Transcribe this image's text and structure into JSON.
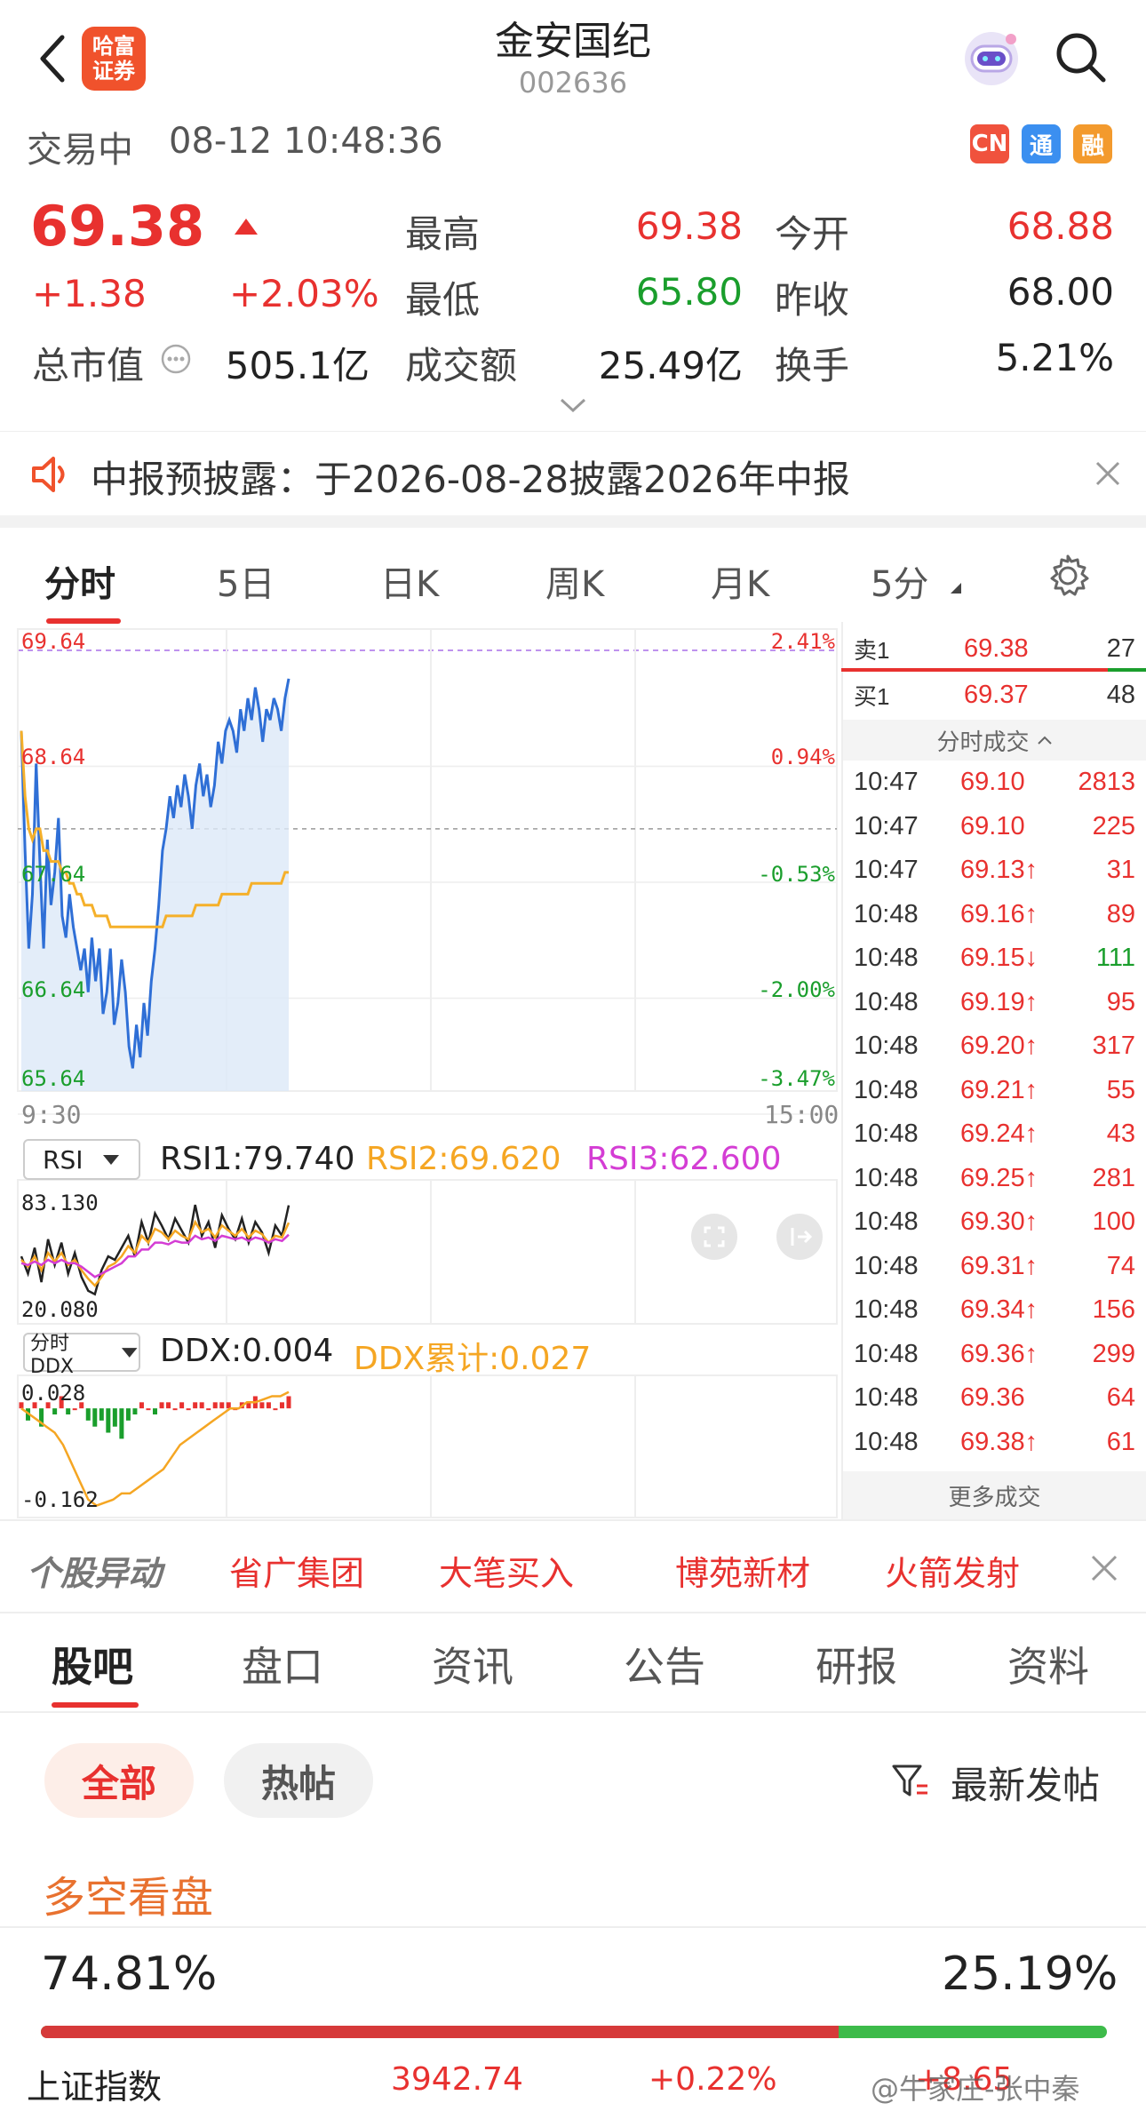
{
  "header": {
    "back_icon": "chevron-left-icon",
    "logo_line1": "哈富",
    "logo_line2": "证券",
    "stock_name": "金安国纪",
    "stock_code": "002636",
    "assistant_icon": "robot-avatar-icon",
    "search_icon": "search-icon"
  },
  "status": {
    "state": "交易中",
    "datetime": "08-12 10:48:36",
    "badges": [
      "CN",
      "通",
      "融"
    ],
    "badge_colors": [
      "#f0523d",
      "#3b8ff0",
      "#f39a2d"
    ]
  },
  "quote": {
    "price": "69.38",
    "change": "+1.38",
    "change_pct": "+2.03%",
    "mcap_label": "总市值",
    "mcap_value": "505.1亿",
    "high_label": "最高",
    "high_value": "69.38",
    "low_label": "最低",
    "low_value": "65.80",
    "amount_label": "成交额",
    "amount_value": "25.49亿",
    "open_label": "今开",
    "open_value": "68.88",
    "prev_label": "昨收",
    "prev_value": "68.00",
    "turnover_label": "换手",
    "turnover_value": "5.21%"
  },
  "notice": {
    "text": "中报预披露：于2026-08-28披露2026年中报"
  },
  "chart_tabs": [
    "分时",
    "5日",
    "日K",
    "周K",
    "月K",
    "5分"
  ],
  "chart_data": [
    {
      "type": "line",
      "title": "",
      "xlabel": "",
      "ylabel": "",
      "x_range": [
        "9:30",
        "15:00"
      ],
      "y_ticks_left": [
        "69.64",
        "68.64",
        "67.64",
        "66.64",
        "65.64"
      ],
      "y_ticks_right": [
        "2.41%",
        "0.94%",
        "-0.53%",
        "-2.00%",
        "-3.47%"
      ],
      "ylim": [
        65.64,
        69.64
      ],
      "prev_close": 68.0,
      "series": [
        {
          "values": [
            68.9,
            67.8,
            66.9,
            67.4,
            68.6,
            67.7,
            66.9,
            67.9,
            67.3,
            67.6,
            68.1,
            67.2,
            67.0,
            67.4,
            67.1,
            66.9,
            66.7,
            66.9,
            66.5,
            67.0,
            66.6,
            66.9,
            66.3,
            66.5,
            66.9,
            66.2,
            66.4,
            66.8,
            66.5,
            66.0,
            65.8,
            66.2,
            65.9,
            66.4,
            66.1,
            66.6,
            66.9,
            67.3,
            67.8,
            68.0,
            68.3,
            68.1,
            68.4,
            68.2,
            68.5,
            68.3,
            68.0,
            68.4,
            68.6,
            68.3,
            68.5,
            68.2,
            68.4,
            68.8,
            68.6,
            68.9,
            69.0,
            68.9,
            68.7,
            69.1,
            68.9,
            69.2,
            69.0,
            69.3,
            69.1,
            68.8,
            69.1,
            69.0,
            69.2,
            69.1,
            68.9,
            69.2,
            69.38
          ]
        },
        {
          "values": [
            68.9,
            68.3,
            68.0,
            67.9,
            68.0,
            68.0,
            67.8,
            67.8,
            67.7,
            67.7,
            67.7,
            67.6,
            67.6,
            67.5,
            67.5,
            67.4,
            67.4,
            67.3,
            67.3,
            67.3,
            67.2,
            67.2,
            67.2,
            67.2,
            67.1,
            67.1,
            67.1,
            67.1,
            67.1,
            67.1,
            67.1,
            67.1,
            67.1,
            67.1,
            67.1,
            67.1,
            67.1,
            67.1,
            67.1,
            67.2,
            67.2,
            67.2,
            67.2,
            67.2,
            67.2,
            67.2,
            67.2,
            67.3,
            67.3,
            67.3,
            67.3,
            67.3,
            67.3,
            67.3,
            67.4,
            67.4,
            67.4,
            67.4,
            67.4,
            67.4,
            67.4,
            67.4,
            67.5,
            67.5,
            67.5,
            67.5,
            67.5,
            67.5,
            67.5,
            67.5,
            67.5,
            67.6,
            67.6
          ]
        }
      ]
    },
    {
      "type": "line",
      "title": "RSI",
      "labels": [
        "RSI1:79.740",
        "RSI2:69.620",
        "RSI3:62.600"
      ],
      "ylim": [
        20.08,
        83.13
      ],
      "y_ticks": [
        "83.130",
        "20.080"
      ],
      "series": [
        {
          "values": [
            50,
            40,
            55,
            35,
            60,
            45,
            58,
            40,
            52,
            38,
            30,
            28,
            42,
            50,
            48,
            55,
            62,
            50,
            70,
            58,
            75,
            68,
            60,
            72,
            65,
            58,
            80,
            62,
            70,
            55,
            74,
            66,
            60,
            72,
            58,
            70,
            64,
            52,
            68,
            62,
            79.7
          ]
        },
        {
          "values": [
            48,
            44,
            50,
            42,
            52,
            47,
            52,
            45,
            48,
            42,
            37,
            33,
            38,
            44,
            46,
            50,
            56,
            52,
            62,
            58,
            66,
            64,
            60,
            65,
            62,
            60,
            70,
            64,
            66,
            61,
            68,
            65,
            62,
            66,
            61,
            65,
            63,
            58,
            62,
            61,
            69.6
          ]
        },
        {
          "values": [
            46,
            45,
            47,
            45,
            48,
            46,
            48,
            46,
            46,
            44,
            41,
            38,
            40,
            42,
            44,
            46,
            50,
            50,
            54,
            54,
            58,
            58,
            57,
            59,
            58,
            58,
            62,
            60,
            61,
            59,
            62,
            61,
            60,
            61,
            59,
            61,
            60,
            58,
            60,
            59,
            62.6
          ]
        }
      ]
    },
    {
      "type": "bar",
      "title": "分时DDX",
      "labels": [
        "DDX:0.004",
        "DDX累计:0.027"
      ],
      "ylim": [
        -0.162,
        0.028
      ],
      "y_ticks": [
        "0.028",
        "-0.162"
      ],
      "bars": [
        0.01,
        -0.02,
        0.01,
        -0.03,
        0.01,
        -0.01,
        0.02,
        -0.01,
        0.0,
        0.01,
        -0.02,
        -0.03,
        -0.02,
        -0.04,
        -0.03,
        -0.05,
        -0.02,
        -0.01,
        0.01,
        0.0,
        -0.01,
        0.01,
        0.01,
        0.0,
        0.01,
        0.0,
        0.01,
        0.01,
        0.0,
        0.01,
        0.01,
        0.01,
        0.0,
        0.01,
        0.01,
        0.02,
        0.01,
        0.01,
        0.0,
        0.01,
        0.02
      ],
      "cum": [
        0.0,
        -0.01,
        -0.02,
        -0.03,
        -0.04,
        -0.06,
        -0.09,
        -0.12,
        -0.15,
        -0.16,
        -0.155,
        -0.15,
        -0.14,
        -0.14,
        -0.13,
        -0.12,
        -0.11,
        -0.1,
        -0.08,
        -0.06,
        -0.05,
        -0.04,
        -0.03,
        -0.02,
        -0.01,
        0.0,
        0.0,
        0.01,
        0.01,
        0.015,
        0.02,
        0.02,
        0.027
      ]
    }
  ],
  "rsi_selector": "RSI",
  "ddx_selector": "分时DDX",
  "order_book": {
    "ask_label": "卖1",
    "ask_price": "69.38",
    "ask_vol": "27",
    "bid_label": "买1",
    "bid_price": "69.37",
    "bid_vol": "48",
    "ticks_header": "分时成交",
    "ticks": [
      {
        "t": "10:47",
        "p": "69.10",
        "v": "2813",
        "c": "#e8312f"
      },
      {
        "t": "10:47",
        "p": "69.10",
        "v": "225",
        "c": "#e8312f"
      },
      {
        "t": "10:47",
        "p": "69.13↑",
        "v": "31",
        "c": "#e8312f"
      },
      {
        "t": "10:48",
        "p": "69.16↑",
        "v": "89",
        "c": "#e8312f"
      },
      {
        "t": "10:48",
        "p": "69.15↓",
        "v": "111",
        "c": "#1a9e2c"
      },
      {
        "t": "10:48",
        "p": "69.19↑",
        "v": "95",
        "c": "#e8312f"
      },
      {
        "t": "10:48",
        "p": "69.20↑",
        "v": "317",
        "c": "#e8312f"
      },
      {
        "t": "10:48",
        "p": "69.21↑",
        "v": "55",
        "c": "#e8312f"
      },
      {
        "t": "10:48",
        "p": "69.24↑",
        "v": "43",
        "c": "#e8312f"
      },
      {
        "t": "10:48",
        "p": "69.25↑",
        "v": "281",
        "c": "#e8312f"
      },
      {
        "t": "10:48",
        "p": "69.30↑",
        "v": "100",
        "c": "#e8312f"
      },
      {
        "t": "10:48",
        "p": "69.31↑",
        "v": "74",
        "c": "#e8312f"
      },
      {
        "t": "10:48",
        "p": "69.34↑",
        "v": "156",
        "c": "#e8312f"
      },
      {
        "t": "10:48",
        "p": "69.36↑",
        "v": "299",
        "c": "#e8312f"
      },
      {
        "t": "10:48",
        "p": "69.36",
        "v": "64",
        "c": "#e8312f"
      },
      {
        "t": "10:48",
        "p": "69.38↑",
        "v": "61",
        "c": "#e8312f"
      }
    ],
    "more": "更多成交"
  },
  "hot_strip": {
    "label": "个股异动",
    "items": [
      "省广集团",
      "大笔买入",
      "博苑新材",
      "火箭发射"
    ]
  },
  "bottom_tabs": [
    "股吧",
    "盘口",
    "资讯",
    "公告",
    "研报",
    "资料"
  ],
  "filters": {
    "all": "全部",
    "hot": "热帖",
    "sort": "最新发帖"
  },
  "sentiment": {
    "title": "多空看盘",
    "bull_pct": "74.81%",
    "bear_pct": "25.19%",
    "bull_share": 0.7481
  },
  "index_bar": {
    "name": "上证指数",
    "value": "3942.74",
    "pct": "+0.22%",
    "change": "+8.65"
  },
  "watermark": "@牛家庄-张中秦"
}
